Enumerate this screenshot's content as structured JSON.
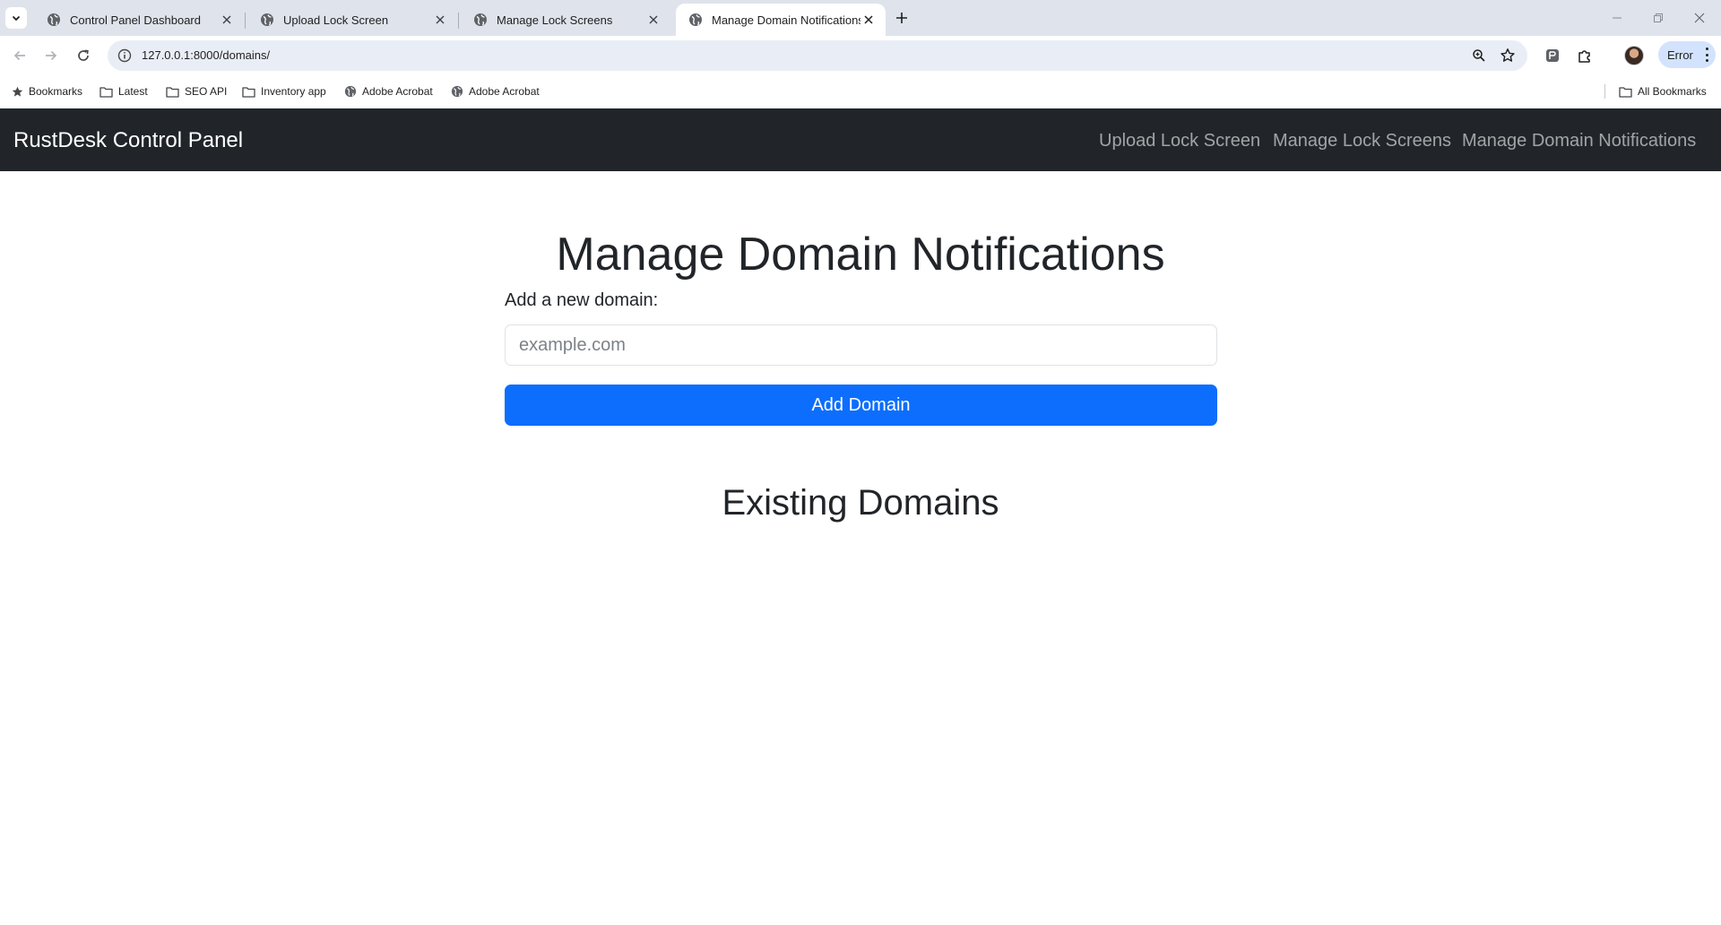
{
  "browser": {
    "tabs": [
      {
        "title": "Control Panel Dashboard",
        "active": false
      },
      {
        "title": "Upload Lock Screen",
        "active": false
      },
      {
        "title": "Manage Lock Screens",
        "active": false
      },
      {
        "title": "Manage Domain Notifications",
        "active": true
      }
    ],
    "url": "127.0.0.1:8000/domains/",
    "profile_status": "Error",
    "bookmarks": [
      {
        "label": "Bookmarks",
        "icon": "star-icon"
      },
      {
        "label": "Latest",
        "icon": "folder-icon"
      },
      {
        "label": "SEO API",
        "icon": "folder-icon"
      },
      {
        "label": "Inventory app",
        "icon": "folder-icon"
      },
      {
        "label": "Adobe Acrobat",
        "icon": "globe-icon"
      },
      {
        "label": "Adobe Acrobat",
        "icon": "globe-icon"
      }
    ],
    "all_bookmarks": "All Bookmarks",
    "accent_color": "#d3e3fd"
  },
  "app": {
    "brand": "RustDesk Control Panel",
    "nav": [
      "Upload Lock Screen",
      "Manage Lock Screens",
      "Manage Domain Notifications"
    ],
    "navbar_color": "#212529"
  },
  "main": {
    "title": "Manage Domain Notifications",
    "field_label": "Add a new domain:",
    "input_value": "",
    "input_placeholder": "example.com",
    "add_button": "Add Domain",
    "button_color": "#0d6efd",
    "existing_title": "Existing Domains"
  }
}
